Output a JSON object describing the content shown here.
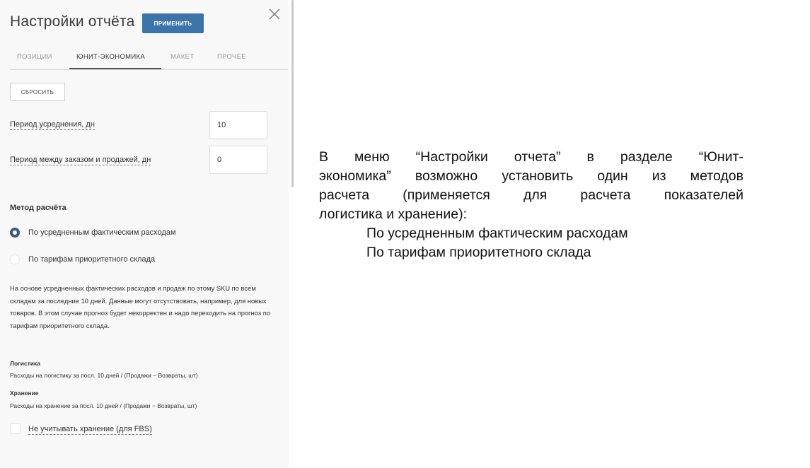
{
  "panel": {
    "title": "Настройки отчёта",
    "apply_label": "ПРИМЕНИТЬ",
    "close_icon": "close-icon",
    "tabs": [
      {
        "label": "ПОЗИЦИИ",
        "active": false
      },
      {
        "label": "ЮНИТ-ЭКОНОМИКА",
        "active": true
      },
      {
        "label": "МАКЕТ",
        "active": false
      },
      {
        "label": "ПРОЧЕЕ",
        "active": false
      }
    ],
    "reset_label": "СБРОСИТЬ",
    "fields": [
      {
        "label": "Период усреднения, дн",
        "value": "10"
      },
      {
        "label": "Период между заказом и продажей, дн",
        "value": "0"
      }
    ],
    "method": {
      "title": "Метод расчёта",
      "options": [
        {
          "label": "По усредненным фактическим расходам",
          "checked": true
        },
        {
          "label": "По тарифам приоритетного склада",
          "checked": false
        }
      ]
    },
    "description": "На основе усредненных фактических расходов и продаж по этому SKU по всем складам за последние 10 дней. Данные могут отсутствовать, например, для новых товаров. В этом случае прогноз будет некорректен и надо переходить на прогноз по тарифам приоритетного склада.",
    "logistics": {
      "title": "Логистика",
      "formula": "Расходы на логистику за посл. 10 дней / (Продажи − Возвраты, шт)"
    },
    "storage": {
      "title": "Хранение",
      "formula": "Расходы на хранение за посл. 10 дней / (Продажи − Возвраты, шт)"
    },
    "checkbox": {
      "label": "Не учитывать хранение (для FBS)",
      "checked": false
    }
  },
  "note": {
    "lines": [
      "В меню “Настройки отчета” в разделе “Юнит-",
      "экономика” возможно установить один из методов",
      "расчета (применяется для расчета показателей",
      "логистика и хранение):"
    ],
    "items": [
      "По усредненным фактическим расходам",
      "По тарифам приоритетного склада"
    ]
  },
  "colors": {
    "accent": "#3c73a8",
    "radio_checked": "#3c5a80",
    "panel_bg": "#f8f8f8"
  }
}
